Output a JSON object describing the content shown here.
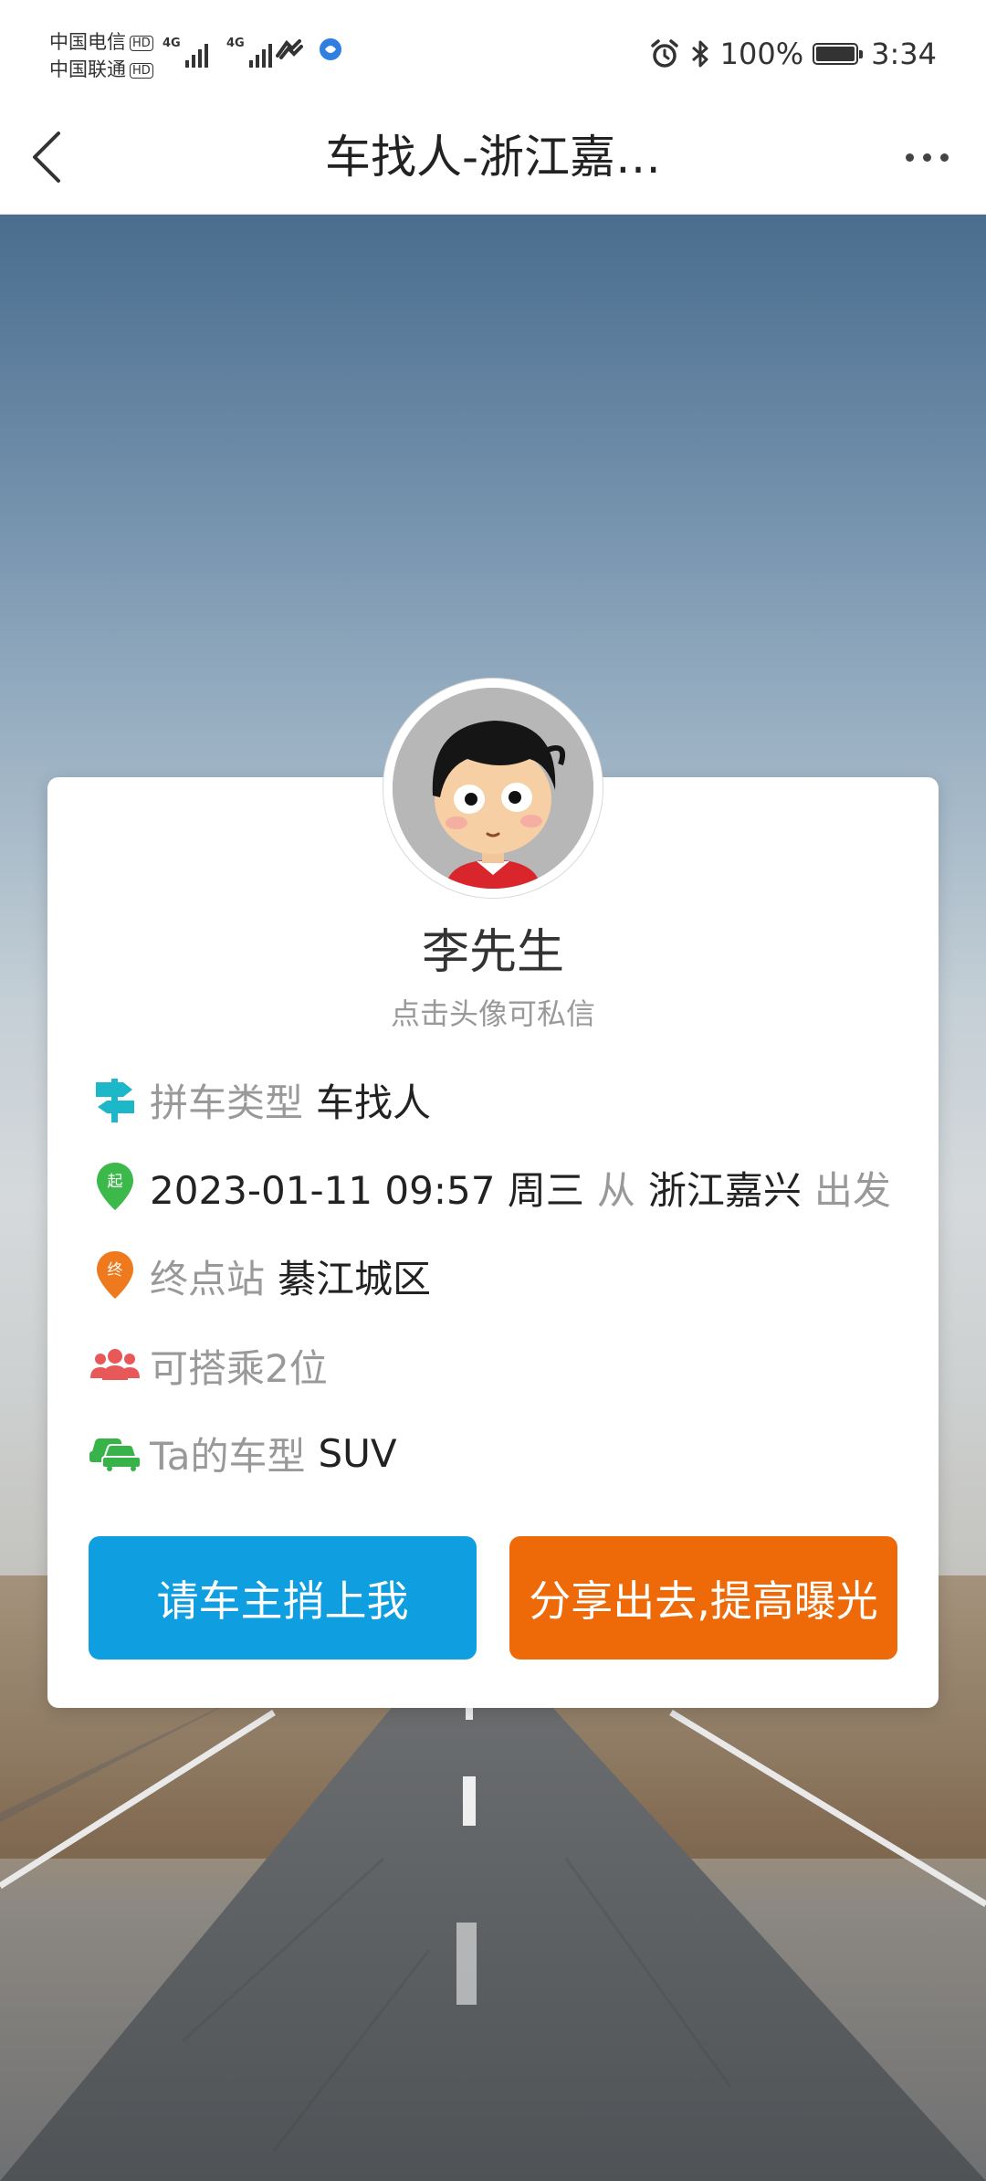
{
  "status_bar": {
    "carrier_1": "中国电信",
    "carrier_2": "中国联通",
    "hd": "HD",
    "net_1": "4G",
    "net_2": "4G",
    "battery": "100%",
    "time": "3:34"
  },
  "nav": {
    "title": "车找人-浙江嘉…"
  },
  "profile": {
    "name": "李先生",
    "hint": "点击头像可私信"
  },
  "info": {
    "type_label": "拼车类型",
    "type_value": "车找人",
    "datetime": "2023-01-11 09:57 周三",
    "from_label": "从",
    "origin": "浙江嘉兴",
    "depart_label": "出发",
    "dest_label": "终点站",
    "dest_value": "綦江城区",
    "seats": "可搭乘2位",
    "car_label": "Ta的车型",
    "car_value": "SUV",
    "start_marker": "起",
    "end_marker": "终"
  },
  "actions": {
    "request": "请车主捎上我",
    "share": "分享出去,提高曝光"
  },
  "colors": {
    "request_button": "#0f9fe1",
    "share_button": "#ee6908",
    "origin_pin": "#3db84a",
    "dest_pin": "#ee7a1d",
    "type_icon": "#1cb8c9",
    "seats_icon": "#e85858",
    "car_icon": "#37b34a"
  },
  "icons": {
    "back": "chevron-left-icon",
    "more": "more-dots-icon",
    "type": "signpost-icon",
    "origin": "map-pin-start-icon",
    "dest": "map-pin-end-icon",
    "seats": "people-icon",
    "car": "car-icon"
  }
}
